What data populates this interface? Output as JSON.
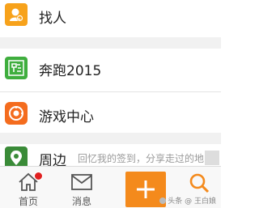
{
  "menu": {
    "items": [
      {
        "label": "找人",
        "icon": "find-person-icon"
      },
      {
        "label": "奔跑2015",
        "icon": "run-icon"
      },
      {
        "label": "游戏中心",
        "icon": "game-center-icon"
      },
      {
        "label": "周边",
        "subtitle": "回忆我的签到，分享走过的地",
        "icon": "nearby-icon"
      }
    ]
  },
  "tabbar": {
    "home_label": "首页",
    "messages_label": "消息",
    "add_icon": "plus-icon",
    "search_icon": "search-icon"
  },
  "watermark": "头条 @ 王白娘",
  "colors": {
    "accent_orange": "#f48a1c",
    "green": "#3fae3e",
    "badge_red": "#e02020"
  }
}
